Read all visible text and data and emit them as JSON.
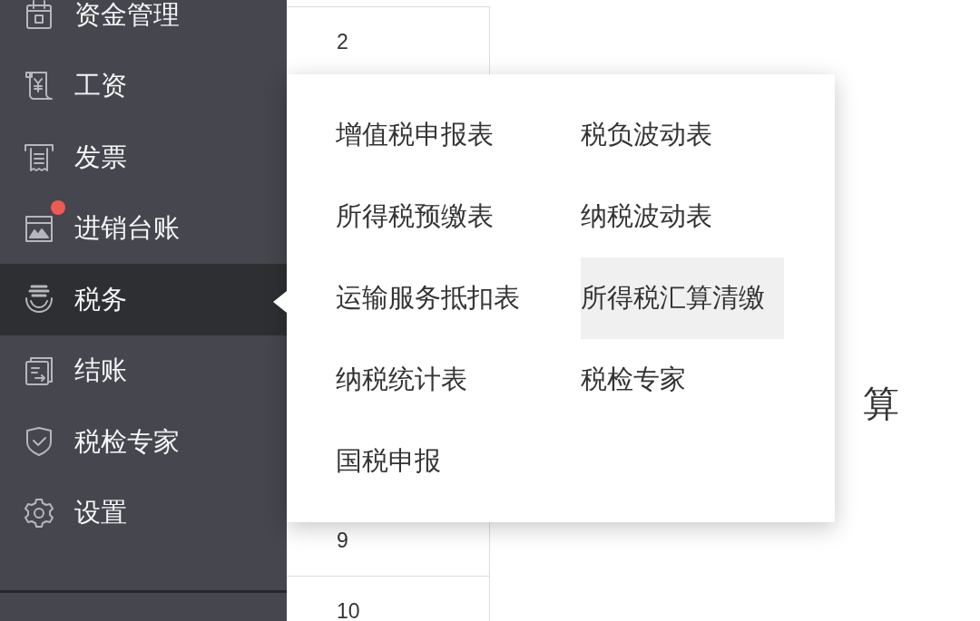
{
  "sidebar": {
    "items": [
      {
        "label": "资金管理",
        "selected": false,
        "dot": false
      },
      {
        "label": "工资",
        "selected": false,
        "dot": false
      },
      {
        "label": "发票",
        "selected": false,
        "dot": false
      },
      {
        "label": "进销台账",
        "selected": false,
        "dot": true
      },
      {
        "label": "税务",
        "selected": true,
        "dot": false
      },
      {
        "label": "结账",
        "selected": false,
        "dot": false
      },
      {
        "label": "税检专家",
        "selected": false,
        "dot": false
      },
      {
        "label": "设置",
        "selected": false,
        "dot": false
      }
    ]
  },
  "table": {
    "rows": [
      {
        "cell": "2"
      },
      {
        "cell": "9"
      },
      {
        "cell": "10"
      }
    ]
  },
  "heading": {
    "text": "算"
  },
  "tax_menu": {
    "items": [
      {
        "label": "增值税申报表",
        "selected": false
      },
      {
        "label": "税负波动表",
        "selected": false
      },
      {
        "label": "所得税预缴表",
        "selected": false
      },
      {
        "label": "纳税波动表",
        "selected": false
      },
      {
        "label": "运输服务抵扣表",
        "selected": false
      },
      {
        "label": "所得税汇算清缴",
        "selected": true
      },
      {
        "label": "纳税统计表",
        "selected": false
      },
      {
        "label": "税检专家",
        "selected": false
      },
      {
        "label": "国税申报",
        "selected": false
      }
    ]
  }
}
